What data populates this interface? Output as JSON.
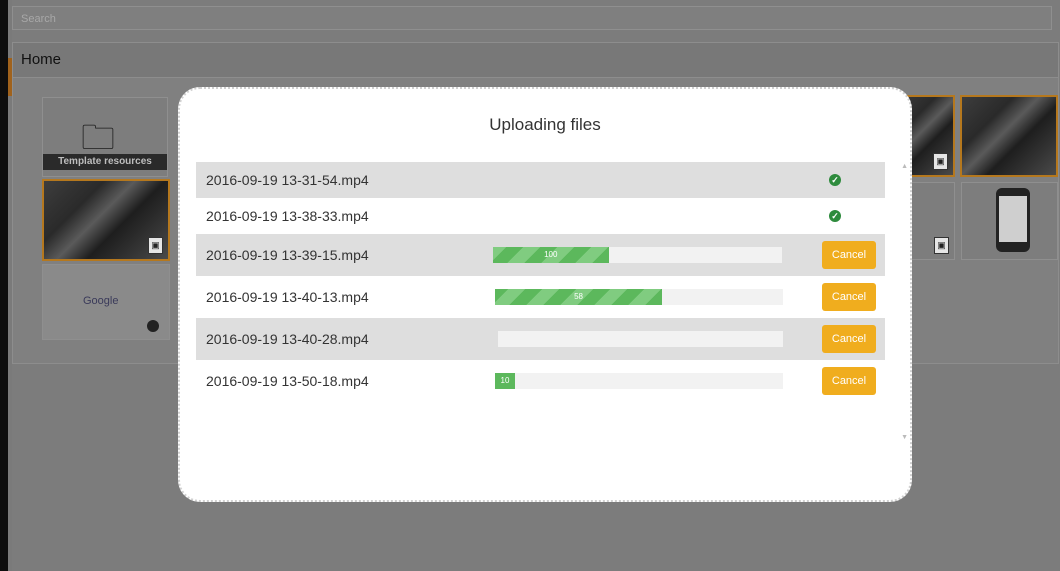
{
  "search": {
    "placeholder": "Search"
  },
  "home": {
    "title": "Home",
    "tiles": {
      "template_resources": "Template resources",
      "google_logo_text": "Google"
    }
  },
  "modal": {
    "title": "Uploading files",
    "cancel_label": "Cancel",
    "files": [
      {
        "name": "2016-09-19 13-31-54.mp4",
        "status": "done"
      },
      {
        "name": "2016-09-19 13-38-33.mp4",
        "status": "done"
      },
      {
        "name": "2016-09-19 13-39-15.mp4",
        "status": "uploading",
        "progress": 100,
        "progress_label": "100"
      },
      {
        "name": "2016-09-19 13-40-13.mp4",
        "status": "uploading",
        "progress": 58,
        "progress_label": "58"
      },
      {
        "name": "2016-09-19 13-40-28.mp4",
        "status": "uploading",
        "progress": 0,
        "progress_label": ""
      },
      {
        "name": "2016-09-19 13-50-18.mp4",
        "status": "uploading",
        "progress": 10,
        "progress_label": "10"
      }
    ]
  },
  "colors": {
    "accent_orange": "#f0ad1e",
    "progress_green": "#5cb85c",
    "done_green": "#2e8b3d",
    "selection_orange": "#b5781e"
  },
  "icons": {
    "done": "check-circle-icon",
    "image_badge": "image-icon",
    "folder": "folder-icon",
    "globe": "globe-icon"
  }
}
